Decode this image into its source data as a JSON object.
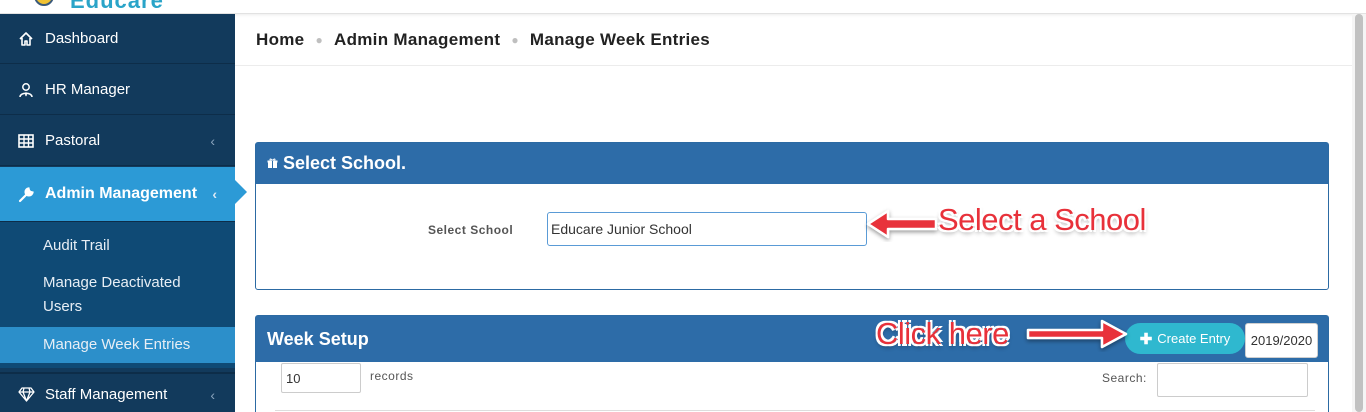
{
  "app": {
    "logo_text": "Educare"
  },
  "sidebar": {
    "items": [
      {
        "label": "Dashboard",
        "icon": "home-icon"
      },
      {
        "label": "HR Manager",
        "icon": "user-tie-icon"
      },
      {
        "label": "Pastoral",
        "icon": "table-icon",
        "chevron": "‹"
      },
      {
        "label": "Admin Management",
        "icon": "wrench-icon",
        "chevron": "‹",
        "active": true
      },
      {
        "label": "Staff Management",
        "icon": "diamond-icon",
        "chevron": "‹"
      }
    ],
    "submenu": [
      {
        "label": "Audit Trail"
      },
      {
        "label": "Manage Deactivated Users"
      },
      {
        "label": "Manage Week Entries",
        "current": true
      }
    ]
  },
  "breadcrumb": [
    "Home",
    "Admin Management",
    "Manage Week Entries"
  ],
  "select_school_panel": {
    "title": "Select School.",
    "field_label": "Select School",
    "field_value": "Educare Junior School"
  },
  "week_setup_panel": {
    "title": "Week Setup",
    "create_button": "Create Entry",
    "year": "2019/2020",
    "records_value": "10",
    "records_label": "records",
    "search_label": "Search:"
  },
  "annotations": {
    "select_school": "Select a School",
    "click_here": "Click here"
  },
  "colors": {
    "sidebar_bg": "#123a5c",
    "sidebar_active": "#2c9ad6",
    "panel_header": "#2d6ca8",
    "create_button": "#2fb8cf",
    "annotation": "#e8313a"
  }
}
